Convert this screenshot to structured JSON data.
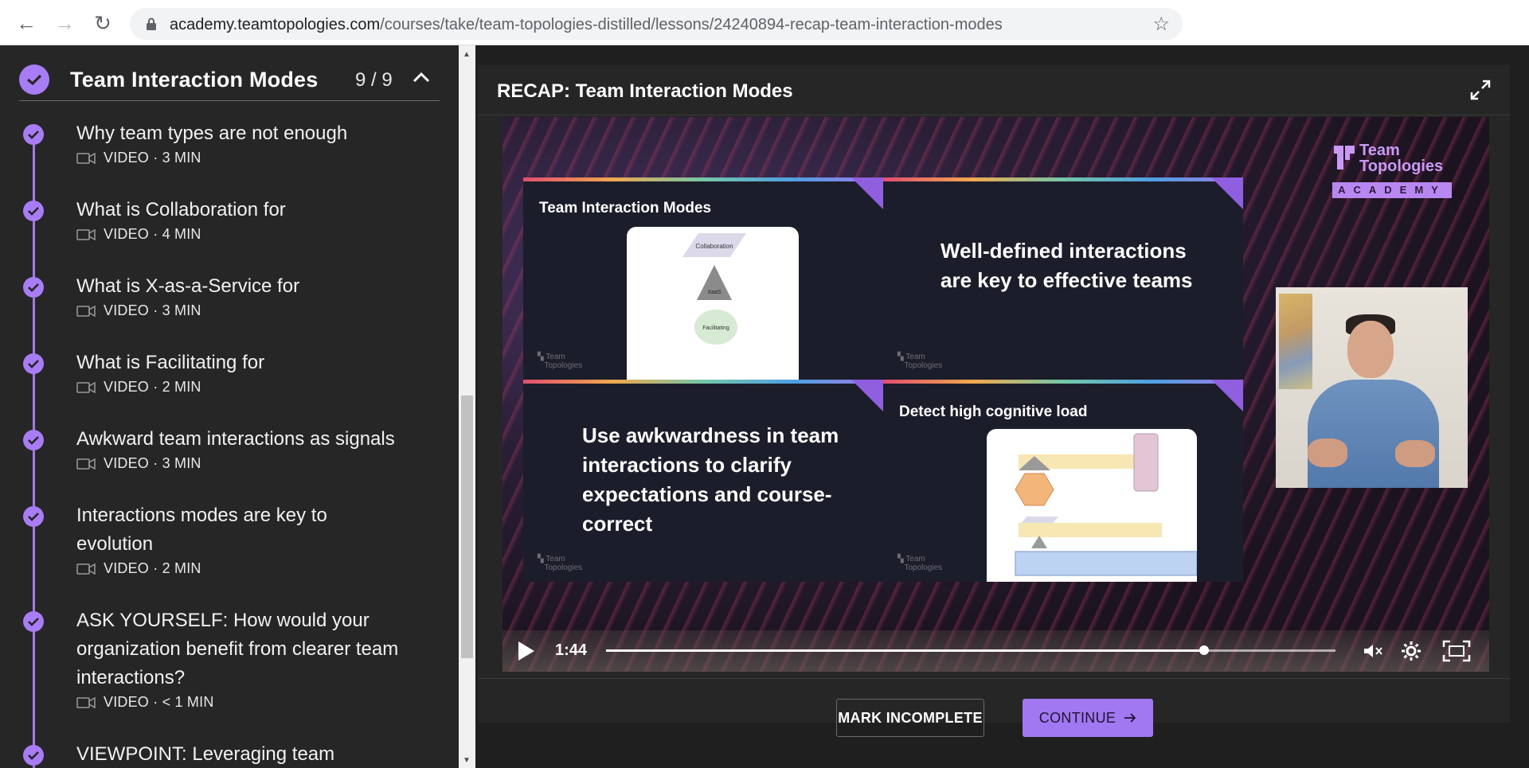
{
  "browser": {
    "url_host": "academy.teamtopologies.com",
    "url_path": "/courses/take/team-topologies-distilled/lessons/24240894-recap-team-interaction-modes"
  },
  "sidebar": {
    "section_title": "Team Interaction Modes",
    "section_count": "9 / 9",
    "lessons": [
      {
        "title": "Why team types are not enough",
        "meta": "VIDEO · 3 MIN"
      },
      {
        "title": "What is Collaboration for",
        "meta": "VIDEO · 4 MIN"
      },
      {
        "title": "What is X-as-a-Service for",
        "meta": "VIDEO · 3 MIN"
      },
      {
        "title": "What is Facilitating for",
        "meta": "VIDEO · 2 MIN"
      },
      {
        "title": "Awkward team interactions as signals",
        "meta": "VIDEO · 3 MIN"
      },
      {
        "title": "Interactions modes are key to evolution",
        "meta": "VIDEO · 2 MIN"
      },
      {
        "title": "ASK YOURSELF: How would your organization benefit from clearer team interactions?",
        "meta": "VIDEO · < 1 MIN"
      },
      {
        "title": "VIEWPOINT: Leveraging team",
        "meta": ""
      }
    ]
  },
  "player": {
    "title": "RECAP: Team Interaction Modes",
    "brand_line1": "Team",
    "brand_line2": "Topologies",
    "brand_academy": "ACADEMY",
    "slides": {
      "s1_heading": "Team Interaction Modes",
      "s1_card_top": "Collaboration",
      "s1_card_mid": "XaaS",
      "s1_card_bottom": "Facilitating",
      "s2_text": "Well-defined interactions are key to effective teams",
      "s3_text": "Use awkwardness in team interactions to clarify expectations and course-correct",
      "s4_heading": "Detect high cognitive load"
    },
    "time": "1:44",
    "progress": 0.82
  },
  "actions": {
    "mark_incomplete": "MARK INCOMPLETE",
    "continue": "CONTINUE"
  }
}
